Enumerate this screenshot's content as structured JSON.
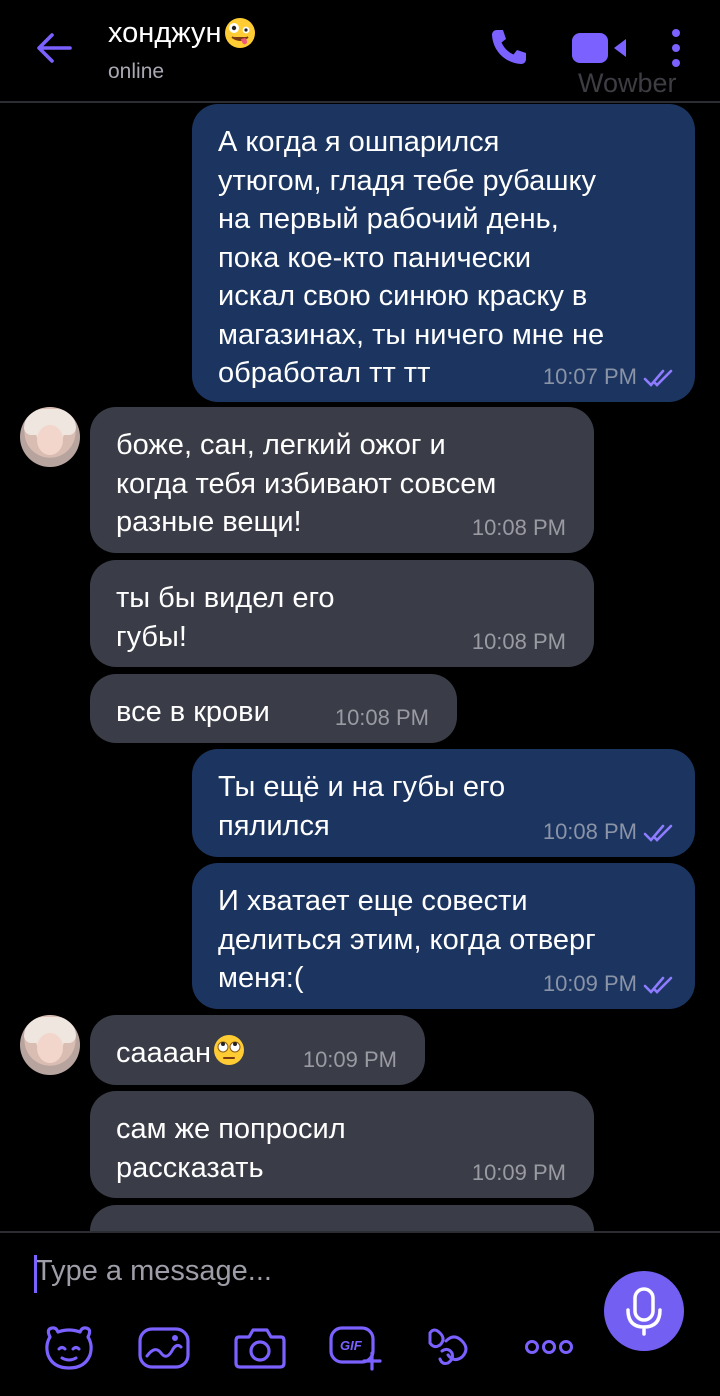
{
  "header": {
    "contact_name": "хонджун",
    "contact_emoji": "zany-face-emoji",
    "status": "online",
    "watermark": "Wowber",
    "icons": [
      "back-arrow-icon",
      "phone-icon",
      "video-call-icon",
      "more-vertical-icon"
    ]
  },
  "messages": [
    {
      "dir": "out",
      "text": "А когда я ошпарился\nутюгом, гладя тебе рубашку\nна первый рабочий день,\nпока кое-кто панически\nискал свою синюю краску в\nмагазинах, ты ничего мне не\nобработал тт тт",
      "time": "10:07 PM",
      "read": true
    },
    {
      "dir": "in",
      "avatar": true,
      "text": "боже, сан, легкий ожог и\nкогда тебя избивают совсем\nразные вещи!",
      "time": "10:08 PM"
    },
    {
      "dir": "in",
      "text": "ты бы видел его\nгубы!",
      "time": "10:08 PM"
    },
    {
      "dir": "in",
      "text": "все в крови",
      "time": "10:08 PM"
    },
    {
      "dir": "out",
      "text": "Ты ещё и на губы его\nпялился",
      "time": "10:08 PM",
      "read": true
    },
    {
      "dir": "out",
      "text": "И хватает еще совести\nделиться этим, когда отверг\nменя:(",
      "time": "10:09 PM",
      "read": true
    },
    {
      "dir": "in",
      "avatar": true,
      "text": "саааан",
      "emoji": "rolling-eyes-emoji",
      "time": "10:09 PM"
    },
    {
      "dir": "in",
      "text": "сам же попросил\nрассказать",
      "time": "10:09 PM"
    },
    {
      "dir": "in",
      "text": "",
      "time": ""
    }
  ],
  "composer": {
    "placeholder": "Type a message...",
    "tools": [
      "sticker-bear-icon",
      "doodle-icon",
      "camera-icon",
      "gif-icon",
      "emoticon-icon",
      "more-icon"
    ],
    "send_icon": "microphone-icon"
  },
  "colors": {
    "accent": "#7360f2",
    "outgoing_bubble": "#1b3560",
    "incoming_bubble": "#3a3d47",
    "background": "#000000"
  }
}
